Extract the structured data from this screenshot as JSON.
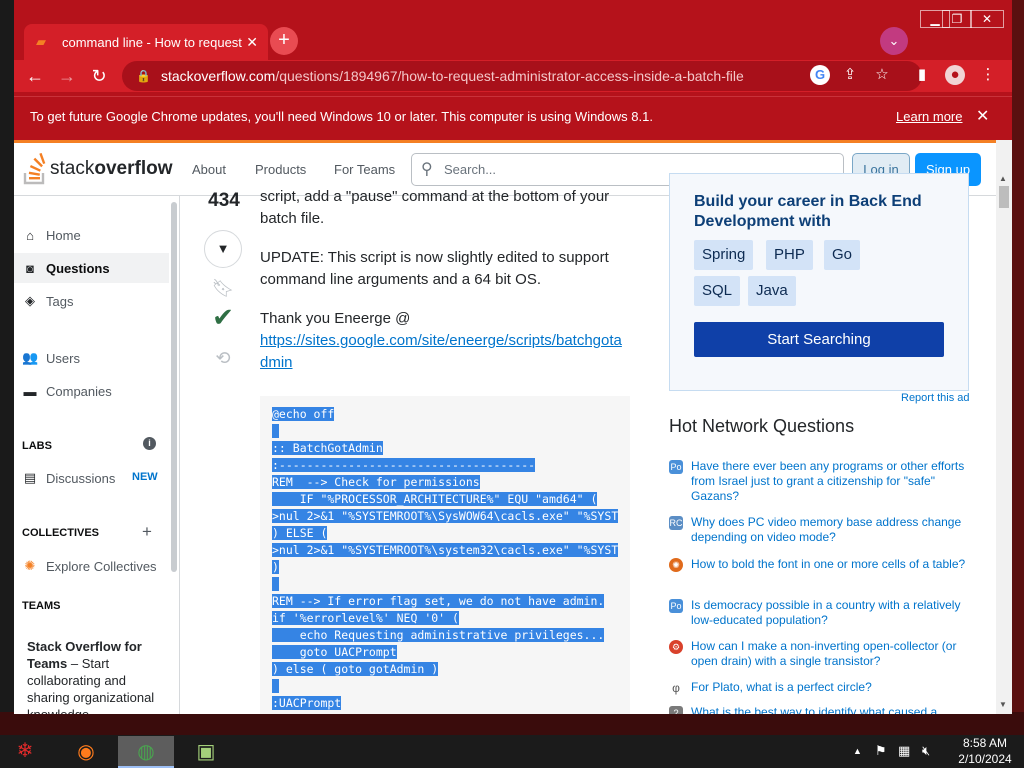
{
  "browser": {
    "tab_title": "command line - How to request",
    "url_host": "stackoverflow.com",
    "url_path": "/questions/1894967/how-to-request-administrator-access-inside-a-batch-file",
    "infobar_text": "To get future Google Chrome updates, you'll need Windows 10 or later. This computer is using Windows 8.1.",
    "infobar_link": "Learn more"
  },
  "header": {
    "logo_light": "stack",
    "logo_bold": "overflow",
    "nav": [
      "About",
      "Products",
      "For Teams"
    ],
    "search_placeholder": "Search...",
    "login": "Log in",
    "signup": "Sign up"
  },
  "leftnav": {
    "home": "Home",
    "questions": "Questions",
    "tags": "Tags",
    "users": "Users",
    "companies": "Companies",
    "labs": "LABS",
    "discussions": "Discussions",
    "new_badge": "NEW",
    "collectives": "COLLECTIVES",
    "explore_collectives": "Explore Collectives",
    "teams": "TEAMS",
    "teams_promo_title": "Stack Overflow for Teams",
    "teams_promo_text": " – Start collaborating and sharing organizational knowledge."
  },
  "post": {
    "votes": "434",
    "para1": "script, add a \"pause\" command at the bottom of your batch file.",
    "para2": "UPDATE: This script is now slightly edited to support command line arguments and a 64 bit OS.",
    "para3": "Thank you Eneerge @",
    "link": "https://sites.google.com/site/eneerge/scripts/batchgotadmin",
    "code_lines": [
      "@echo off",
      "",
      ":: BatchGotAdmin",
      ":-------------------------------------",
      "REM  --> Check for permissions",
      "    IF \"%PROCESSOR_ARCHITECTURE%\" EQU \"amd64\" (",
      ">nul 2>&1 \"%SYSTEMROOT%\\SysWOW64\\cacls.exe\" \"%SYST",
      ") ELSE (",
      ">nul 2>&1 \"%SYSTEMROOT%\\system32\\cacls.exe\" \"%SYST",
      ")",
      "",
      "REM --> If error flag set, we do not have admin.",
      "if '%errorlevel%' NEQ '0' (",
      "    echo Requesting administrative privileges...",
      "    goto UACPrompt",
      ") else ( goto gotAdmin )",
      "",
      ":UACPrompt"
    ]
  },
  "ad": {
    "title": "Build your career in Back End Development with",
    "chips": [
      "Spring",
      "PHP",
      "Go",
      "SQL",
      "Java"
    ],
    "button": "Start Searching",
    "report": "Report this ad"
  },
  "hnq": {
    "title": "Hot Network Questions",
    "items": [
      "Have there ever been any programs or other efforts from Israel just to grant a citizenship for \"safe\" Gazans?",
      "Why does PC video memory base address change depending on video mode?",
      "How to bold the font in one or more cells of a table?",
      "Is democracy possible in a country with a relatively low-educated population?",
      "How can I make a non-inverting open-collector (or open drain) with a single transistor?",
      "For Plato, what is a perfect circle?",
      "What is the best way to identify what caused a"
    ]
  },
  "taskbar": {
    "time": "8:58 AM",
    "date": "2/10/2024"
  },
  "colors": {
    "chrome_red": "#b5121b",
    "so_orange": "#f48024",
    "link_blue": "#0074cc",
    "selection_blue": "#3584e4"
  }
}
